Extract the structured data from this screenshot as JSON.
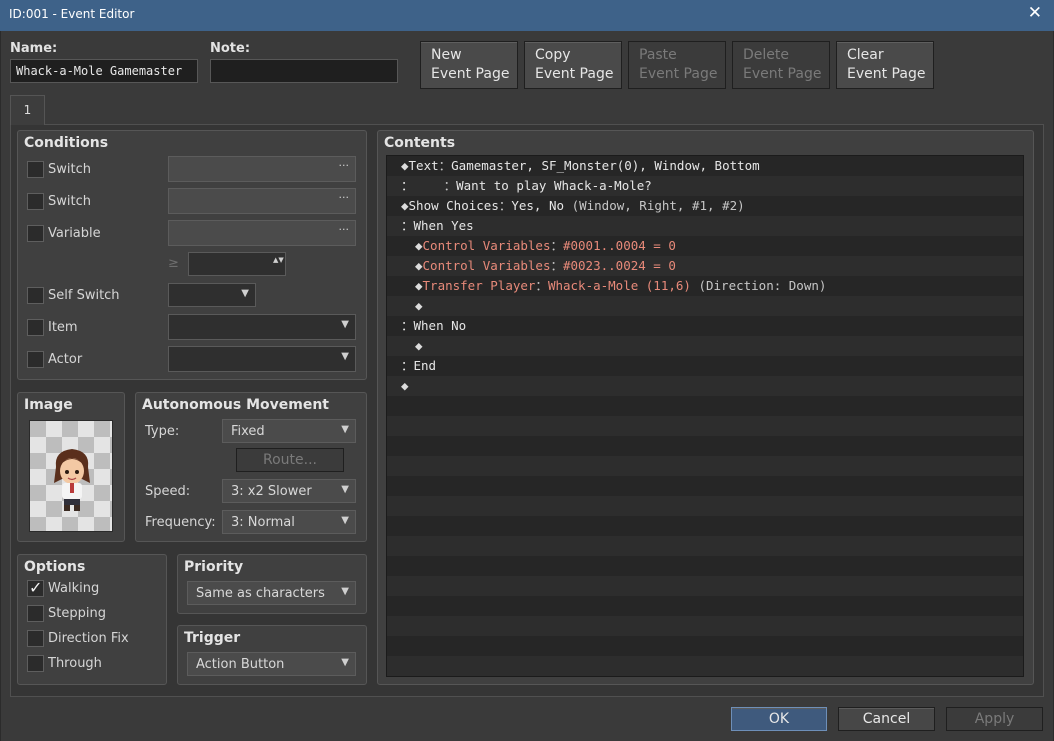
{
  "window": {
    "title": "ID:001 - Event Editor",
    "close_glyph": "✕"
  },
  "name_label": "Name:",
  "name_value": "Whack-a-Mole Gamemaster",
  "note_label": "Note:",
  "note_value": "",
  "page_buttons": [
    {
      "l1": "New",
      "l2": "Event Page",
      "enabled": true
    },
    {
      "l1": "Copy",
      "l2": "Event Page",
      "enabled": true
    },
    {
      "l1": "Paste",
      "l2": "Event Page",
      "enabled": false
    },
    {
      "l1": "Delete",
      "l2": "Event Page",
      "enabled": false
    },
    {
      "l1": "Clear",
      "l2": "Event Page",
      "enabled": true
    }
  ],
  "tab_label": "1",
  "conditions": {
    "title": "Conditions",
    "switch1": "Switch",
    "switch2": "Switch",
    "variable": "Variable",
    "ge": "≥",
    "self_switch": "Self Switch",
    "item": "Item",
    "actor": "Actor",
    "dots": "···",
    "arrow": "▼",
    "spin": "▲▼"
  },
  "image": {
    "title": "Image"
  },
  "movement": {
    "title": "Autonomous Movement",
    "type_label": "Type:",
    "type_value": "Fixed",
    "route_label": "Route...",
    "speed_label": "Speed:",
    "speed_value": "3: x2 Slower",
    "frequency_label": "Frequency:",
    "frequency_value": "3: Normal"
  },
  "options": {
    "title": "Options",
    "walking": "Walking",
    "stepping": "Stepping",
    "direction_fix": "Direction Fix",
    "through": "Through"
  },
  "priority": {
    "title": "Priority",
    "value": "Same as characters"
  },
  "trigger": {
    "title": "Trigger",
    "value": "Action Button"
  },
  "contents": {
    "title": "Contents",
    "lines": [
      {
        "dia": "◆",
        "cmd": "Text",
        "sep": "：",
        "arg": "Gamemaster, SF_Monster(0), Window, Bottom",
        "color": "white"
      },
      {
        "dia": "",
        "cmd": "：",
        "sep": "    ：",
        "arg": "Want to play Whack-a-Mole?",
        "color": "white"
      },
      {
        "dia": "◆",
        "cmd": "Show Choices",
        "sep": "：",
        "arg": "Yes, No",
        "extra": " (Window, Right, #1, #2)",
        "color": "white"
      },
      {
        "dia": "",
        "cmd": "：When Yes",
        "sep": "",
        "arg": "",
        "color": "white"
      },
      {
        "dia": "◆",
        "cmd": "Control Variables",
        "sep": "：",
        "arg": "#0001..0004 = 0",
        "color": "red"
      },
      {
        "dia": "◆",
        "cmd": "Control Variables",
        "sep": "：",
        "arg": "#0023..0024 = 0",
        "color": "red"
      },
      {
        "dia": "◆",
        "cmd": "Transfer Player",
        "sep": "：",
        "arg": "Whack-a-Mole (11,6)",
        "extra": " (Direction: Down)",
        "color": "red"
      },
      {
        "dia": "◆",
        "cmd": "",
        "sep": "",
        "arg": "",
        "color": "white"
      },
      {
        "dia": "",
        "cmd": "：When No",
        "sep": "",
        "arg": "",
        "color": "white"
      },
      {
        "dia": "◆",
        "cmd": "",
        "sep": "",
        "arg": "",
        "color": "white"
      },
      {
        "dia": "",
        "cmd": "：End",
        "sep": "",
        "arg": "",
        "color": "white"
      },
      {
        "dia": "◆",
        "cmd": "",
        "sep": "",
        "arg": "",
        "color": "white"
      }
    ]
  },
  "footer": {
    "ok": "OK",
    "cancel": "Cancel",
    "apply": "Apply"
  },
  "colors": {
    "accent": "#3e6289",
    "red_cmd": "#e88a7a"
  }
}
